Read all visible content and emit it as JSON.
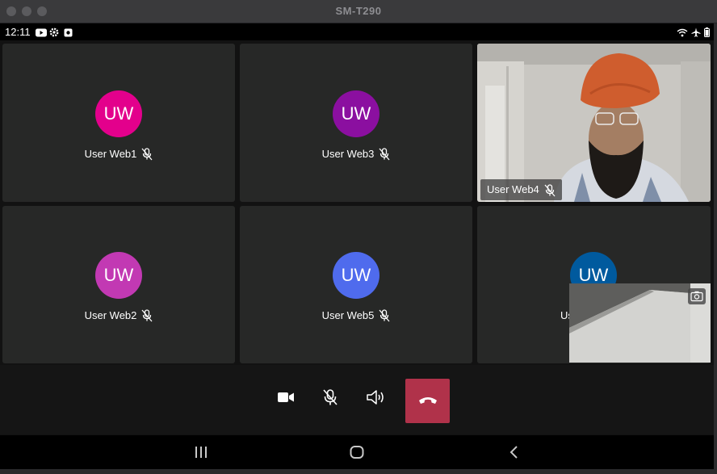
{
  "window": {
    "title": "SM-T290"
  },
  "status_bar": {
    "time": "12:11"
  },
  "participants": [
    {
      "initials": "UW",
      "name": "User Web1",
      "color": "#e3008c",
      "muted": true
    },
    {
      "initials": "UW",
      "name": "User Web3",
      "color": "#8b0fa0",
      "muted": true
    },
    {
      "name": "User Web4",
      "video": true,
      "muted": true
    },
    {
      "initials": "UW",
      "name": "User Web2",
      "color": "#c239b3",
      "muted": true
    },
    {
      "initials": "UW",
      "name": "User Web5",
      "color": "#4f6bed",
      "muted": true
    },
    {
      "initials": "UW",
      "name": "Us",
      "color": "#005a9e",
      "muted": true
    }
  ],
  "controls": {
    "camera_icon": "video-camera-icon",
    "mic_icon": "microphone-off-icon",
    "speaker_icon": "speaker-icon",
    "hangup_icon": "phone-hangup-icon",
    "hangup_color": "#b0324a"
  },
  "navigation": {
    "recents_icon": "recents-icon",
    "home_icon": "home-icon",
    "back_icon": "back-icon"
  }
}
